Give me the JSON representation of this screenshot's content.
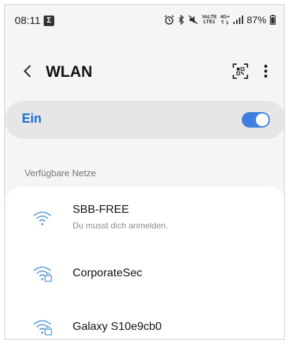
{
  "status_bar": {
    "time": "08:11",
    "notification_badge": "Σ",
    "lte_top": "VoLTE",
    "lte_bottom": "LTE1",
    "network_type": "4G+",
    "battery": "87%"
  },
  "app_bar": {
    "title": "WLAN"
  },
  "master_switch": {
    "label": "Ein",
    "state": "on"
  },
  "section_header": "Verfügbare Netze",
  "networks": [
    {
      "name": "SBB-FREE",
      "subtitle": "Du musst dich anmelden.",
      "secured": false
    },
    {
      "name": "CorporateSec",
      "secured": true
    },
    {
      "name": "Galaxy S10e9cb0",
      "secured": true
    }
  ],
  "colors": {
    "accent": "#1a6fd4",
    "toggle": "#3e7fe0",
    "wifi_icon": "#68a3d8"
  }
}
